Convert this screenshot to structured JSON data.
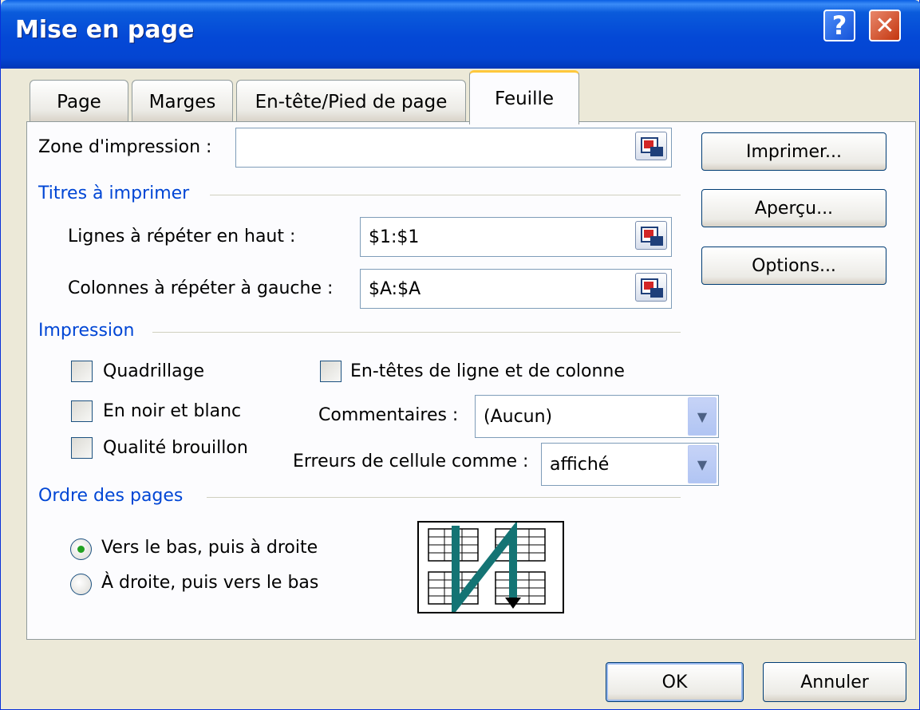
{
  "window": {
    "title": "Mise en page",
    "help_glyph": "?",
    "close_glyph": "✕"
  },
  "tabs": [
    {
      "label": "Page",
      "active": false
    },
    {
      "label": "Marges",
      "active": false
    },
    {
      "label": "En-tête/Pied de page",
      "active": false
    },
    {
      "label": "Feuille",
      "active": true
    }
  ],
  "print_area": {
    "label": "Zone d'impression :",
    "value": ""
  },
  "titles_group": {
    "label": "Titres à imprimer",
    "rows_label": "Lignes à répéter en haut :",
    "rows_value": "$1:$1",
    "cols_label": "Colonnes à répéter à gauche :",
    "cols_value": "$A:$A"
  },
  "print_group": {
    "label": "Impression",
    "gridlines": {
      "label": "Quadrillage",
      "checked": false
    },
    "black_white": {
      "label": "En noir et blanc",
      "checked": false
    },
    "draft": {
      "label": "Qualité brouillon",
      "checked": false
    },
    "headings": {
      "label": "En-têtes de ligne et de colonne",
      "checked": false
    },
    "comments_label": "Commentaires :",
    "comments_value": "(Aucun)",
    "errors_label": "Erreurs de cellule comme :",
    "errors_value": "affiché"
  },
  "order_group": {
    "label": "Ordre des pages",
    "down_then_over": {
      "label": "Vers le bas, puis à droite",
      "selected": true
    },
    "over_then_down": {
      "label": "À droite, puis vers le bas",
      "selected": false
    }
  },
  "side_buttons": {
    "print": "Imprimer...",
    "preview": "Aperçu...",
    "options": "Options..."
  },
  "footer": {
    "ok": "OK",
    "cancel": "Annuler"
  },
  "colors": {
    "title_bar": "#0A5BDB",
    "group_label": "#0046D5",
    "dialog_bg": "#ECE9D8",
    "order_arrow": "#147474"
  }
}
